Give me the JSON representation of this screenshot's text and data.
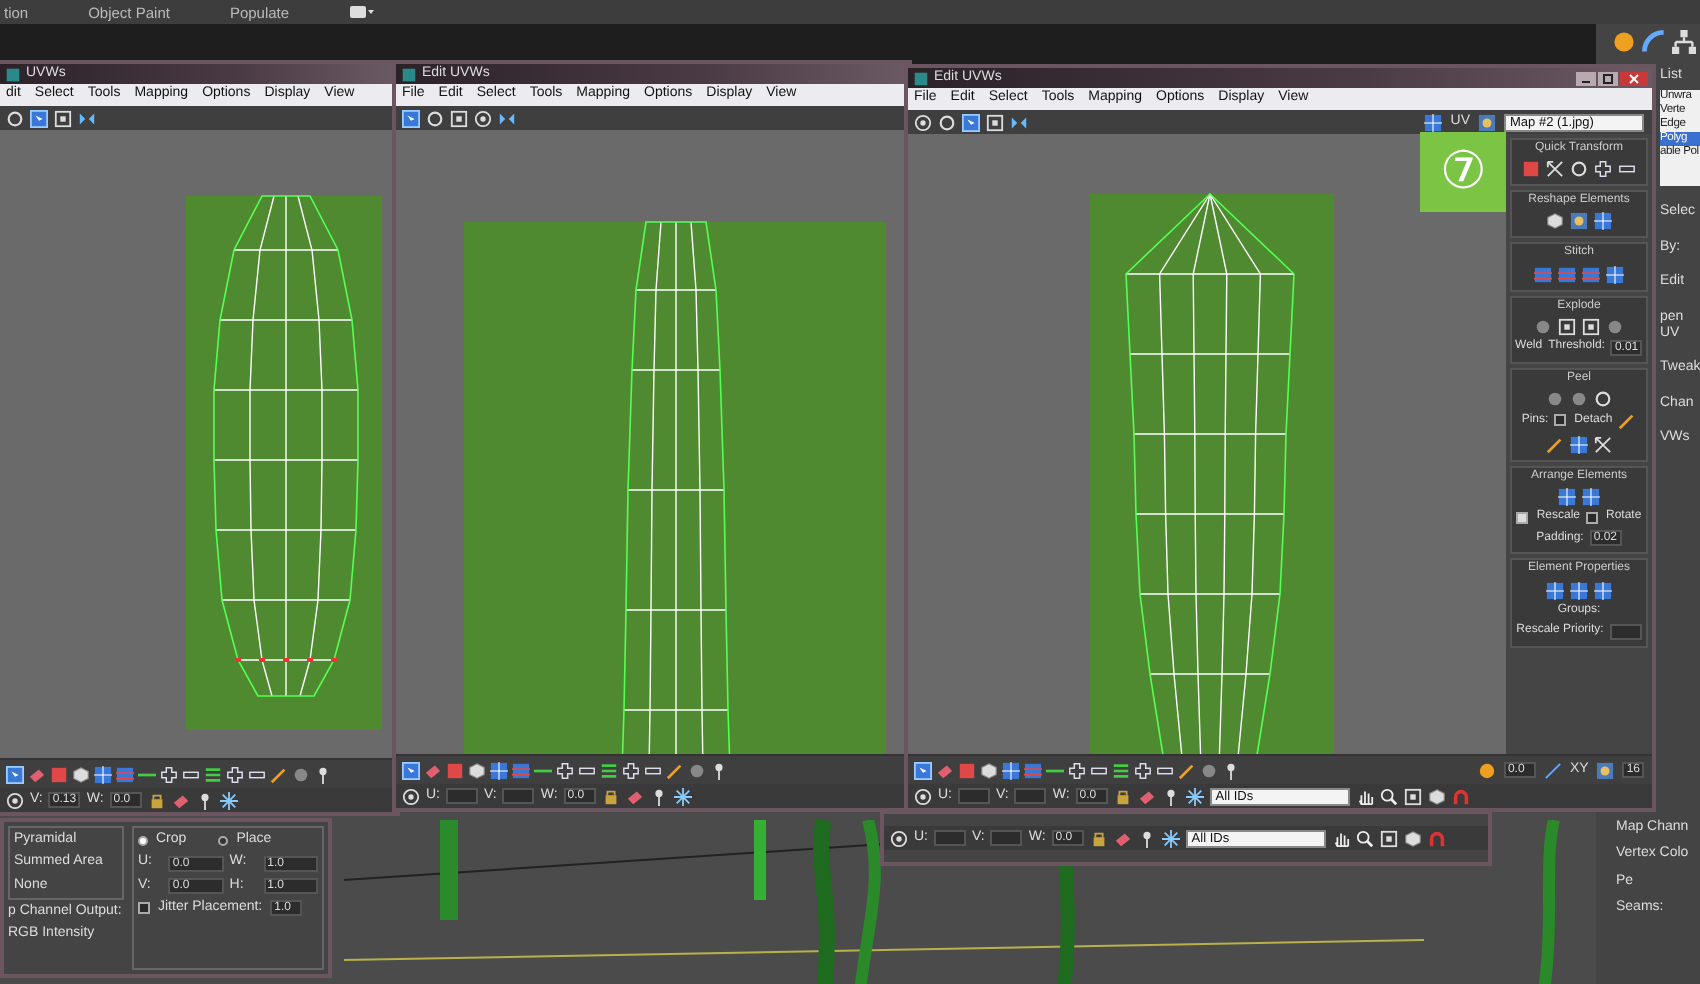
{
  "top_bar": {
    "menu": [
      "tion",
      "Object Paint",
      "Populate"
    ]
  },
  "command_panel": {
    "list_label": "List",
    "stack": [
      {
        "label": "Unwra",
        "selected": false
      },
      {
        "label": "Verte",
        "selected": false
      },
      {
        "label": "Edge",
        "selected": false
      },
      {
        "label": "Polyg",
        "selected": true
      },
      {
        "label": "able Pol",
        "selected": false
      }
    ],
    "labels": [
      "Selec",
      "By:",
      "Edit",
      "pen UV",
      "Tweak",
      "Chan",
      "VWs"
    ],
    "lower_labels": [
      "Map Chann",
      "Vertex Colo",
      "Pe",
      "Seams:"
    ]
  },
  "material_panel": {
    "filtering": [
      "Pyramidal",
      "Summed Area",
      "None"
    ],
    "output_label": "p Channel Output:",
    "output_option": "RGB Intensity",
    "placement": [
      {
        "label": "Crop",
        "selected": true
      },
      {
        "label": "Place",
        "selected": false
      }
    ],
    "fields": [
      {
        "label": "U:",
        "value": "0.0"
      },
      {
        "label": "W:",
        "value": "1.0"
      },
      {
        "label": "V:",
        "value": "0.0"
      },
      {
        "label": "H:",
        "value": "1.0"
      }
    ],
    "jitter": {
      "label": "Jitter Placement:",
      "checked": false,
      "value": "1.0"
    }
  },
  "uv_editors": [
    {
      "title": "UVWs",
      "menu": [
        "dit",
        "Select",
        "Tools",
        "Mapping",
        "Options",
        "Display",
        "View"
      ],
      "coords": [
        {
          "label": "V:",
          "value": "0.13"
        },
        {
          "label": "W:",
          "value": "0.0"
        }
      ]
    },
    {
      "title": "Edit UVWs",
      "menu": [
        "File",
        "Edit",
        "Select",
        "Tools",
        "Mapping",
        "Options",
        "Display",
        "View"
      ],
      "coords": [
        {
          "label": "U:"
        },
        {
          "label": "V:"
        },
        {
          "label": "W:",
          "value": "0.0"
        }
      ]
    },
    {
      "title": "Edit UVWs",
      "menu": [
        "File",
        "Edit",
        "Select",
        "Tools",
        "Mapping",
        "Options",
        "Display",
        "View"
      ],
      "uv_label": "UV",
      "map": "Map #2 (1.jpg)",
      "extras": {
        "value": "0.0",
        "axis": "XY",
        "size": "16"
      },
      "coords": [
        {
          "label": "U:"
        },
        {
          "label": "V:"
        },
        {
          "label": "W:",
          "value": "0.0"
        }
      ],
      "filter": "All IDs",
      "rollouts": [
        {
          "title": "Quick Transform"
        },
        {
          "title": "Reshape Elements"
        },
        {
          "title": "Stitch"
        },
        {
          "title": "Explode",
          "labels": [
            "Weld"
          ],
          "fields": [
            {
              "label": "Threshold:",
              "value": "0.01"
            }
          ]
        },
        {
          "title": "Peel",
          "checks": [
            {
              "label": "Detach",
              "checked": false
            }
          ],
          "labels": [
            "Pins:"
          ]
        },
        {
          "title": "Arrange Elements",
          "checks": [
            {
              "label": "Rescale",
              "checked": true
            },
            {
              "label": "Rotate",
              "checked": false
            }
          ],
          "fields": [
            {
              "label": "Padding:",
              "value": "0.02"
            }
          ]
        },
        {
          "title": "Element Properties",
          "fields": [
            {
              "label": "Rescale Priority:"
            }
          ],
          "labels": [
            "Groups:"
          ]
        }
      ]
    }
  ],
  "background_editor": {
    "coords": [
      {
        "label": "U:"
      },
      {
        "label": "V:"
      },
      {
        "label": "W:",
        "value": "0.0"
      }
    ],
    "filter": "All IDs"
  },
  "step_badge": "⑦"
}
